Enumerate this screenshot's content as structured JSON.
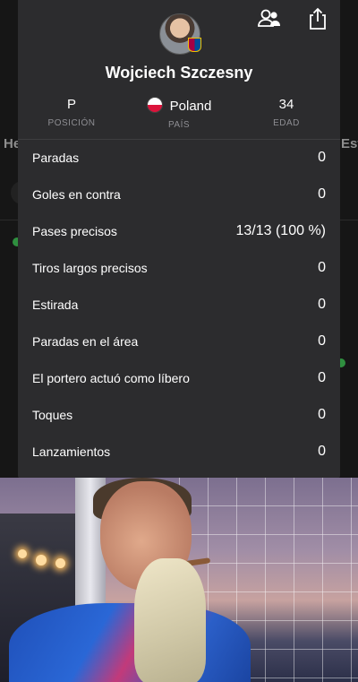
{
  "background": {
    "left_label": "He",
    "right_label": "Est"
  },
  "player": {
    "name": "Wojciech Szczesny",
    "position": {
      "value": "P",
      "label": "POSICIÓN"
    },
    "country": {
      "value": "Poland",
      "label": "PAÍS"
    },
    "age": {
      "value": "34",
      "label": "EDAD"
    }
  },
  "icons": {
    "profile": "person-profile-icon",
    "share": "share-icon",
    "flag_colors": [
      "#ffffff",
      "#dc143c"
    ]
  },
  "stats": [
    {
      "label": "Paradas",
      "value": "0"
    },
    {
      "label": "Goles en contra",
      "value": "0"
    },
    {
      "label": "Pases precisos",
      "value": "13/13 (100 %)"
    },
    {
      "label": "Tiros largos precisos",
      "value": "0"
    },
    {
      "label": "Estirada",
      "value": "0"
    },
    {
      "label": "Paradas en el área",
      "value": "0"
    },
    {
      "label": "El portero actuó como líbero",
      "value": "0"
    },
    {
      "label": "Toques",
      "value": "0"
    },
    {
      "label": "Lanzamientos",
      "value": "0"
    }
  ]
}
